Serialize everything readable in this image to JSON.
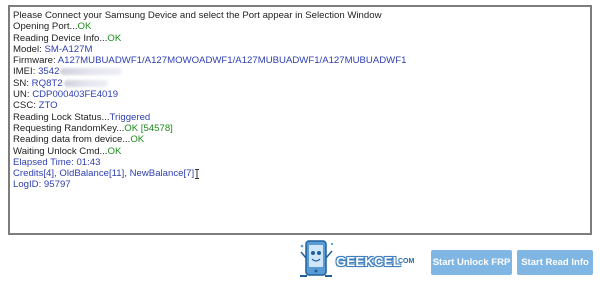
{
  "log": {
    "header": "Please Connect your Samsung Device and select the Port appear in Selection Window",
    "opening_port": {
      "label": "Opening Port...",
      "value": "OK"
    },
    "reading_info": {
      "label": "Reading Device Info...",
      "value": "OK"
    },
    "model": {
      "label": "Model: ",
      "value": "SM-A127M"
    },
    "firmware": {
      "label": "Firmware: ",
      "value": "A127MUBUADWF1/A127MOWOADWF1/A127MUBUADWF1/A127MUBUADWF1"
    },
    "imei": {
      "label": "IMEI: ",
      "value": "3542"
    },
    "sn": {
      "label": "SN: ",
      "value": "RQ8T2"
    },
    "un": {
      "label": "UN: ",
      "value": "CDP000403FE4019"
    },
    "csc": {
      "label": "CSC: ",
      "value": "ZTO"
    },
    "lock_status": {
      "label": "Reading Lock Status...",
      "value": "Triggered"
    },
    "random_key": {
      "label": "Requesting RandomKey...",
      "value": "OK [54578]"
    },
    "reading_data": {
      "label": "Reading data from device...",
      "value": "OK"
    },
    "unlock_cmd": {
      "label": "Waiting Unlock Cmd...",
      "value": "OK"
    },
    "elapsed": "Elapsed Time: 01:43",
    "credits": "Credits[4], OldBalance[11], NewBalance[7]",
    "logid": "LogID: 95797"
  },
  "logo": {
    "text": "GEEKCEL",
    "suffix": "COM"
  },
  "buttons": {
    "unlock_frp": "Start Unlock FRP",
    "read_info": "Start Read Info"
  },
  "colors": {
    "ok": "#1e8a1e",
    "value_blue": "#2f3fb2",
    "button_bg": "#7fb6e3",
    "frame_border": "#7d7d7d",
    "logo_blue": "#3d7fc0"
  }
}
